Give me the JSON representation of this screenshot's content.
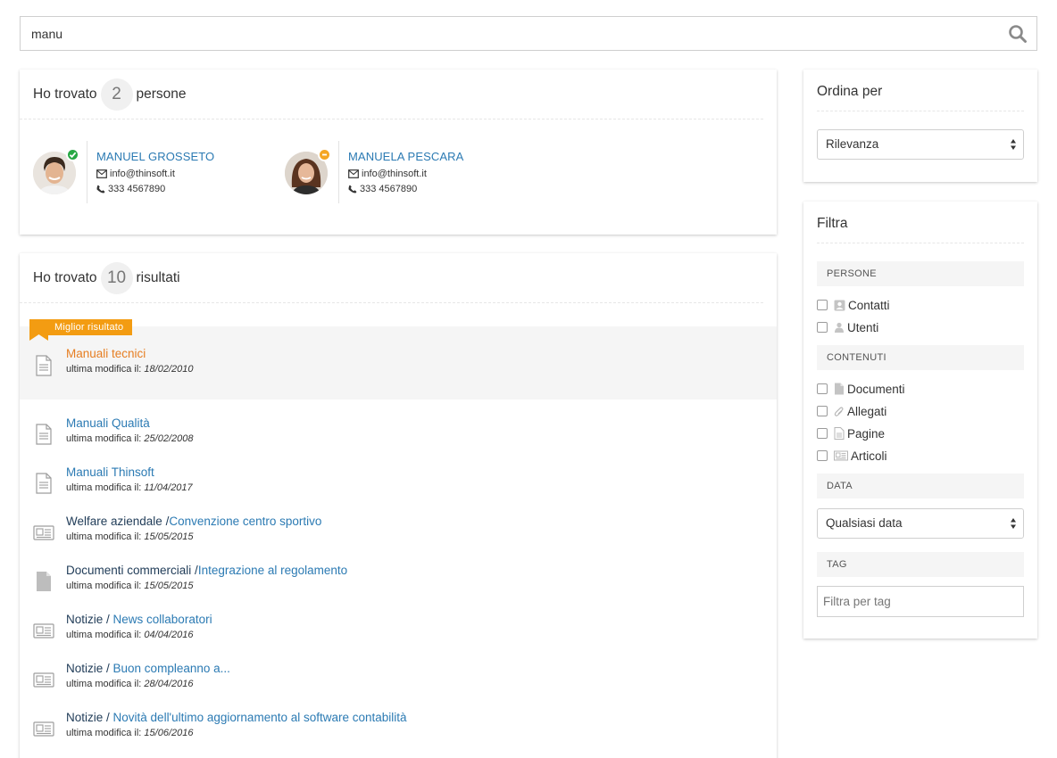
{
  "search": {
    "value": "manu"
  },
  "people": {
    "title_prefix": "Ho trovato",
    "count": "2",
    "title_suffix": "persone",
    "items": [
      {
        "name": "MANUEL GROSSETO",
        "email": "info@thinsoft.it",
        "phone": "333 4567890",
        "status": "online",
        "status_color": "#27a844"
      },
      {
        "name": "MANUELA PESCARA",
        "email": "info@thinsoft.it",
        "phone": "333 4567890",
        "status": "busy",
        "status_color": "#f5a623"
      }
    ]
  },
  "results": {
    "title_prefix": "Ho trovato",
    "count": "10",
    "title_suffix": "risultati",
    "best_label": "Miglior risultato",
    "meta_label": "ultima modifica il:",
    "items": [
      {
        "icon": "document-lines-icon",
        "category": "",
        "sep": "",
        "title": "Manuali tecnici",
        "date": "18/02/2010",
        "best": true
      },
      {
        "icon": "document-lines-icon",
        "category": "",
        "sep": "",
        "title": "Manuali Qualità",
        "date": "25/02/2008"
      },
      {
        "icon": "document-lines-icon",
        "category": "",
        "sep": "",
        "title": "Manuali Thinsoft",
        "date": "11/04/2017"
      },
      {
        "icon": "newspaper-icon",
        "category": "Welfare aziendale",
        "sep": " /",
        "title": "Convenzione centro sportivo",
        "date": "15/05/2015"
      },
      {
        "icon": "document-filled-icon",
        "category": "Documenti commerciali",
        "sep": " /",
        "title": "Integrazione al regolamento",
        "date": "15/05/2015"
      },
      {
        "icon": "newspaper-icon",
        "category": "Notizie",
        "sep": " / ",
        "title": "News collaboratori",
        "date": "04/04/2016"
      },
      {
        "icon": "newspaper-icon",
        "category": "Notizie",
        "sep": " / ",
        "title": "Buon compleanno a...",
        "date": "28/04/2016"
      },
      {
        "icon": "newspaper-icon",
        "category": "Notizie",
        "sep": " / ",
        "title": "Novità dell'ultimo aggiornamento al software contabilità",
        "date": "15/06/2016"
      }
    ]
  },
  "sort": {
    "title": "Ordina per",
    "selected": "Rilevanza"
  },
  "filter": {
    "title": "Filtra",
    "sections": {
      "persone": {
        "label": "PERSONE",
        "options": [
          "Contatti",
          "Utenti"
        ]
      },
      "contenuti": {
        "label": "CONTENUTI",
        "options": [
          "Documenti",
          "Allegati",
          "Pagine",
          "Articoli"
        ]
      },
      "data": {
        "label": "DATA",
        "selected": "Qualsiasi data"
      },
      "tag": {
        "label": "TAG",
        "placeholder": "Filtra per tag"
      }
    }
  },
  "colors": {
    "link": "#2b7ab3",
    "best_link": "#e67e22",
    "ribbon": "#f39c12",
    "category": "#1f3b57"
  }
}
